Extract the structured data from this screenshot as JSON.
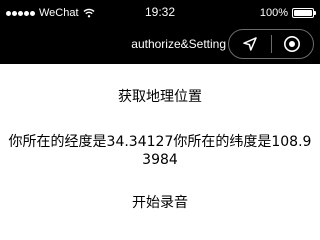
{
  "status_bar": {
    "carrier": "WeChat",
    "time": "19:32",
    "battery": "100%"
  },
  "nav": {
    "title": "authorize&Setting",
    "capsule_icons": [
      "location-arrow-icon",
      "record-circle-icon"
    ]
  },
  "content": {
    "get_location_label": "获取地理位置",
    "coords_text": "你所在的经度是34.34127你所在的纬度是108.93984",
    "start_recording_label": "开始录音"
  }
}
